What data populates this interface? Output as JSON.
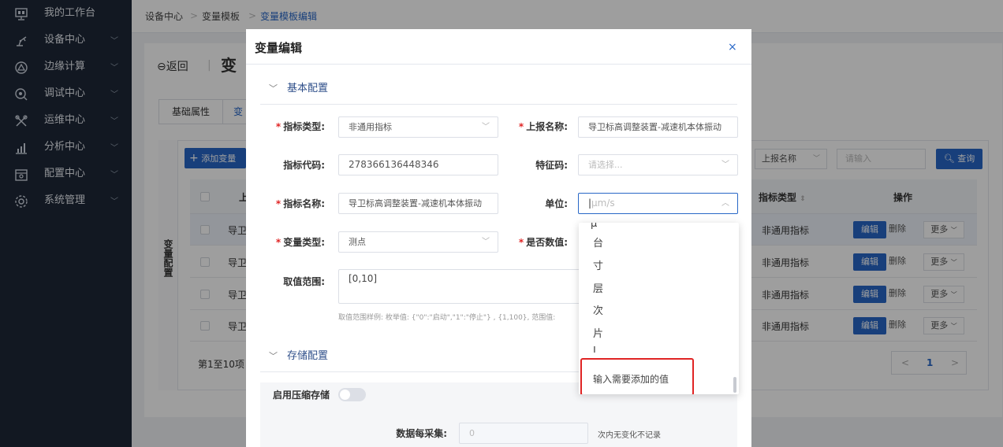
{
  "sidebar": {
    "items": [
      {
        "label": "我的工作台",
        "icon": "dashboard-icon",
        "has_chevron": false
      },
      {
        "label": "设备中心",
        "icon": "robot-arm-icon",
        "has_chevron": true
      },
      {
        "label": "边缘计算",
        "icon": "edge-compute-icon",
        "has_chevron": true
      },
      {
        "label": "调试中心",
        "icon": "debug-icon",
        "has_chevron": true
      },
      {
        "label": "运维中心",
        "icon": "tools-icon",
        "has_chevron": true
      },
      {
        "label": "分析中心",
        "icon": "bar-chart-icon",
        "has_chevron": true
      },
      {
        "label": "配置中心",
        "icon": "config-icon",
        "has_chevron": true
      },
      {
        "label": "系统管理",
        "icon": "gear-icon",
        "has_chevron": true
      }
    ]
  },
  "breadcrumb": {
    "items": [
      "设备中心",
      "变量模板",
      "变量模板编辑"
    ]
  },
  "page": {
    "back_label": "返回",
    "title_partial": "变"
  },
  "tabs": [
    {
      "label": "基础属性"
    },
    {
      "label": "变"
    }
  ],
  "var_panel": {
    "side_label": "变量配置",
    "add_button": "添加变量",
    "filter_select": "上报名称",
    "filter_placeholder": "请输入",
    "search_button": "查询",
    "col_name_partial": "上",
    "col_type": "指标类型",
    "col_ops": "操作",
    "rows": [
      {
        "name": "导卫",
        "type": "非通用指标",
        "edit": "编辑",
        "del": "删除",
        "more": "更多"
      },
      {
        "name": "导卫",
        "type": "非通用指标",
        "edit": "编辑",
        "del": "删除",
        "more": "更多"
      },
      {
        "name": "导卫",
        "type": "非通用指标",
        "edit": "编辑",
        "del": "删除",
        "more": "更多"
      },
      {
        "name": "导卫",
        "type": "非通用指标",
        "edit": "编辑",
        "del": "删除",
        "more": "更多"
      }
    ],
    "pagination_text": "第1至10项",
    "current_page": "1"
  },
  "modal": {
    "title": "变量编辑",
    "section_basic": "基本配置",
    "section_storage": "存储配置",
    "fields": {
      "indicator_type": {
        "label": "指标类型:",
        "value": "非通用指标"
      },
      "report_name": {
        "label": "上报名称:",
        "value": "导卫标高调整装置-减速机本体振动"
      },
      "indicator_code": {
        "label": "指标代码:",
        "value": "278366136448346"
      },
      "feature_code": {
        "label": "特征码:",
        "placeholder": "请选择..."
      },
      "indicator_name": {
        "label": "指标名称:",
        "value": "导卫标高调整装置-减速机本体振动"
      },
      "unit": {
        "label": "单位:",
        "placeholder": "μm/s"
      },
      "var_type": {
        "label": "变量类型:",
        "value": "测点"
      },
      "is_numeric": {
        "label": "是否数值:"
      },
      "value_range": {
        "label": "取值范围:",
        "value": "[0,10]"
      },
      "range_hint": "取值范围样例: 枚举值: {\"0\":\"启动\",\"1\":\"停止\"} , {1,100}, 范围值:"
    },
    "storage": {
      "compress_label": "启用压缩存储",
      "compress_on": false,
      "collect_label": "数据每采集:",
      "collect_value": "0",
      "collect_suffix": "次内无变化不记录"
    }
  },
  "dropdown": {
    "options": [
      "台",
      "寸",
      "层",
      "次",
      "片",
      "L"
    ],
    "add_prompt": "输入需要添加的值",
    "highlight_color": "#e02424"
  },
  "colors": {
    "sidebar_bg": "#1d2737",
    "primary": "#2867c7",
    "required": "#e02424"
  }
}
